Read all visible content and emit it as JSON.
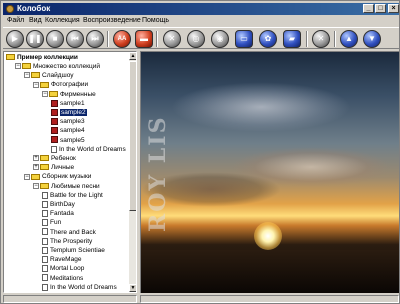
{
  "window": {
    "title": "Колобок",
    "min_glyph": "_",
    "max_glyph": "□",
    "close_glyph": "×"
  },
  "menu": [
    "Файл",
    "Вид",
    "Коллекция",
    "Воспроизведение",
    "Помощь"
  ],
  "toolbar": {
    "buttons": [
      {
        "name": "play-icon",
        "glyph": "▶"
      },
      {
        "name": "pause-icon",
        "glyph": "❚❚"
      },
      {
        "name": "stop-icon",
        "glyph": "■"
      },
      {
        "name": "prev-icon",
        "glyph": "⏮"
      },
      {
        "name": "next-icon",
        "glyph": "⏭"
      },
      {
        "name": "text-icon",
        "glyph": "AA"
      },
      {
        "name": "open-icon",
        "glyph": "▬"
      },
      {
        "name": "tools-icon",
        "glyph": "✕"
      },
      {
        "name": "rings-icon",
        "glyph": "◎"
      },
      {
        "name": "disc-icon",
        "glyph": "◉"
      },
      {
        "name": "window-icon",
        "glyph": "▭"
      },
      {
        "name": "gear-icon",
        "glyph": "✿"
      },
      {
        "name": "cassette-icon",
        "glyph": "▰"
      },
      {
        "name": "close-icon",
        "glyph": "✕"
      },
      {
        "name": "up-icon",
        "glyph": "▲"
      },
      {
        "name": "download-icon",
        "glyph": "▼"
      }
    ]
  },
  "tree": {
    "root": "Пример коллекции",
    "items": [
      {
        "label": "Множество коллекций",
        "level": 1,
        "icon": "folder",
        "exp": "−"
      },
      {
        "label": "Слайдшоу",
        "level": 2,
        "icon": "folder",
        "exp": "−"
      },
      {
        "label": "Фотографии",
        "level": 3,
        "icon": "folder",
        "exp": "−"
      },
      {
        "label": "Фирменные",
        "level": 4,
        "icon": "folder",
        "exp": "−"
      },
      {
        "label": "sample1",
        "level": 5,
        "icon": "image"
      },
      {
        "label": "sample2",
        "level": 5,
        "icon": "image",
        "selected": true
      },
      {
        "label": "sample3",
        "level": 5,
        "icon": "image"
      },
      {
        "label": "sample4",
        "level": 5,
        "icon": "image"
      },
      {
        "label": "sample5",
        "level": 5,
        "icon": "image"
      },
      {
        "label": "In the World of Dreams",
        "level": 5,
        "icon": "doc"
      },
      {
        "label": "Ребенок",
        "level": 3,
        "icon": "folder",
        "exp": "+"
      },
      {
        "label": "Личные",
        "level": 3,
        "icon": "folder",
        "exp": "+"
      },
      {
        "label": "Сборник музыки",
        "level": 2,
        "icon": "folder",
        "exp": "−"
      },
      {
        "label": "Любимые песни",
        "level": 3,
        "icon": "folder",
        "exp": "−"
      },
      {
        "label": "Battle for the Light",
        "level": 4,
        "icon": "doc"
      },
      {
        "label": "BirthDay",
        "level": 4,
        "icon": "doc"
      },
      {
        "label": "Fantada",
        "level": 4,
        "icon": "doc"
      },
      {
        "label": "Fun",
        "level": 4,
        "icon": "doc"
      },
      {
        "label": "There and Back",
        "level": 4,
        "icon": "doc"
      },
      {
        "label": "The Prosperity",
        "level": 4,
        "icon": "doc"
      },
      {
        "label": "Templum Scientiae",
        "level": 4,
        "icon": "doc"
      },
      {
        "label": "RaveMage",
        "level": 4,
        "icon": "doc"
      },
      {
        "label": "Mortal Loop",
        "level": 4,
        "icon": "doc"
      },
      {
        "label": "Meditations",
        "level": 4,
        "icon": "doc"
      },
      {
        "label": "In the World of Dreams",
        "level": 4,
        "icon": "doc"
      }
    ]
  },
  "viewer": {
    "watermark": "ROY LIS"
  }
}
